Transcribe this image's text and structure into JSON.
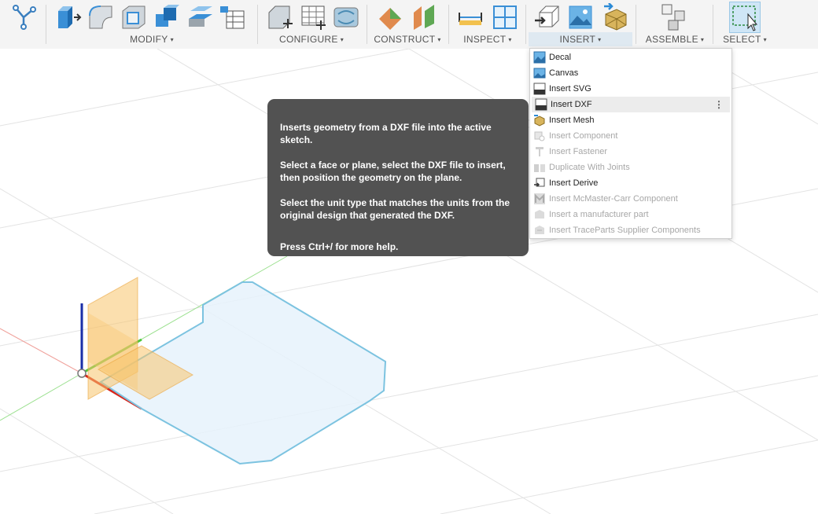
{
  "toolbar": {
    "groups": [
      {
        "label": "MODIFY"
      },
      {
        "label": "CONFIGURE"
      },
      {
        "label": "CONSTRUCT"
      },
      {
        "label": "INSPECT"
      },
      {
        "label": "INSERT"
      },
      {
        "label": "ASSEMBLE"
      },
      {
        "label": "SELECT"
      }
    ],
    "caret": "▾",
    "icons": [
      "sketch-icon",
      "modify-press-pull-icon",
      "fillet-icon",
      "shell-icon",
      "combine-icon",
      "offset-face-icon",
      "change-parameters-icon",
      "configure-icon",
      "configure-table-icon",
      "configure-theme-icon",
      "construct-plane-icon",
      "construct-midplane-icon",
      "measure-icon",
      "interference-icon",
      "insert-derive-icon",
      "insert-canvas-icon",
      "insert-mesh-icon",
      "new-component-icon",
      "select-window-icon"
    ]
  },
  "insert_menu": {
    "items": [
      {
        "label": "Decal",
        "icon": "decal-icon",
        "enabled": true
      },
      {
        "label": "Canvas",
        "icon": "canvas-icon",
        "enabled": true
      },
      {
        "label": "Insert SVG",
        "icon": "svg-file-icon",
        "enabled": true
      },
      {
        "label": "Insert DXF",
        "icon": "dxf-file-icon",
        "enabled": true,
        "hovered": true
      },
      {
        "label": "Insert Mesh",
        "icon": "mesh-icon",
        "enabled": true
      },
      {
        "label": "Insert Component",
        "icon": "component-icon",
        "enabled": false
      },
      {
        "label": "Insert Fastener",
        "icon": "fastener-icon",
        "enabled": false
      },
      {
        "label": "Duplicate With Joints",
        "icon": "duplicate-joints-icon",
        "enabled": false
      },
      {
        "label": "Insert Derive",
        "icon": "derive-icon",
        "enabled": true
      },
      {
        "label": "Insert McMaster-Carr Component",
        "icon": "mcmaster-icon",
        "enabled": false
      },
      {
        "label": "Insert a manufacturer part",
        "icon": "manufacturer-part-icon",
        "enabled": false
      },
      {
        "label": "Insert TraceParts Supplier Components",
        "icon": "traceparts-icon",
        "enabled": false
      }
    ],
    "more_glyph": "⋮"
  },
  "tooltip": {
    "paragraphs": [
      "Inserts geometry from a DXF file into the active sketch.",
      "Select a face or plane, select the DXF file to insert, then position the geometry on the plane.",
      "Select the unit type that matches the units from the original design that generated the DXF."
    ],
    "help": "Press Ctrl+/ for more help."
  },
  "colors": {
    "toolbar_bg": "#f4f4f4",
    "tooltip_bg": "#525252",
    "sketch_fill": "#e6f2fb",
    "sketch_stroke": "#7cc3e0",
    "plane_fill": "#f8c46b",
    "axis_x": "#d9261c",
    "axis_y": "#4cc73a",
    "axis_z": "#1a2ea8"
  }
}
